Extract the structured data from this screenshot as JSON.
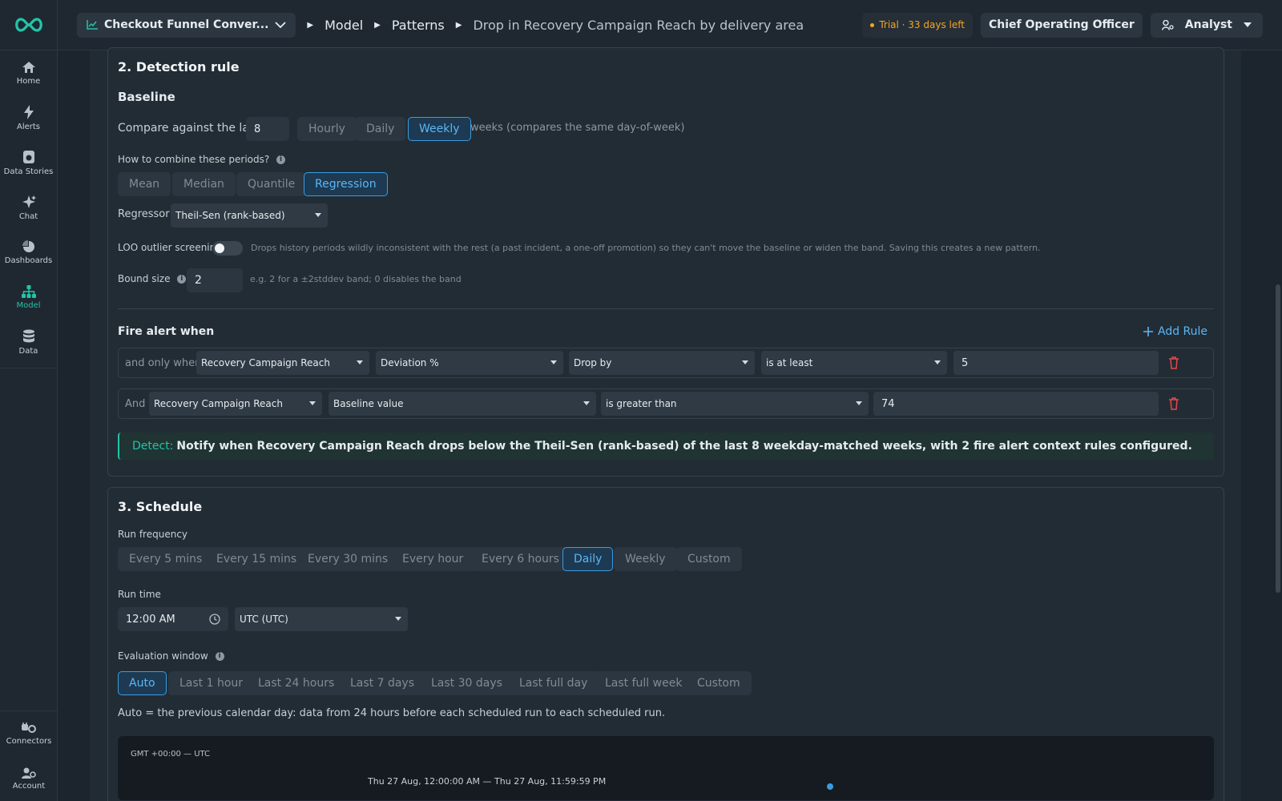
{
  "nav": {
    "items": [
      {
        "label": "Home",
        "icon": "home-icon"
      },
      {
        "label": "Alerts",
        "icon": "bolt-icon"
      },
      {
        "label": "Data Stories",
        "icon": "story-icon"
      },
      {
        "label": "Chat",
        "icon": "sparkle-icon"
      },
      {
        "label": "Dashboards",
        "icon": "pie-icon"
      },
      {
        "label": "Model",
        "icon": "hierarchy-icon"
      },
      {
        "label": "Data",
        "icon": "database-icon"
      }
    ],
    "bottom": [
      {
        "label": "Connectors",
        "icon": "plug-icon"
      },
      {
        "label": "Account",
        "icon": "account-icon"
      }
    ],
    "active_color": "#23c4a8"
  },
  "topbar": {
    "project": "Checkout Funnel Conver...",
    "breadcrumbs": [
      "Model",
      "Patterns",
      "Drop in Recovery Campaign Reach by delivery area"
    ],
    "trial": "Trial · 33 days left",
    "role": "Chief Operating Officer",
    "user": "Analyst"
  },
  "detection": {
    "title": "2. Detection rule",
    "baseline_title": "Baseline",
    "compare_label": "Compare against the last",
    "compare_value": "8",
    "periods": [
      "Hourly",
      "Daily",
      "Weekly"
    ],
    "selected_period": "Weekly",
    "period_hint": "weeks (compares the same day-of-week)",
    "combine_label": "How to combine these periods?",
    "combine": [
      "Mean",
      "Median",
      "Quantile",
      "Regression"
    ],
    "selected_combine": "Regression",
    "regressor_label": "Regressor",
    "regressor_value": "Theil-Sen (rank-based)",
    "loo_label": "LOO outlier screening",
    "loo_hint": "Drops history periods wildly inconsistent with the rest (a past incident, a one-off promotion) so they can't move the baseline or widen the band. Saving this creates a new pattern.",
    "bound_label": "Bound size",
    "bound_value": "2",
    "bound_hint": "e.g. 2 for a ±2stddev band; 0 disables the band",
    "fire_title": "Fire alert when",
    "add_rule": "Add Rule",
    "rules": [
      {
        "prefix": "and only when",
        "metric": "Recovery Campaign Reach",
        "measure": "Deviation %",
        "direction": "Drop by",
        "op": "is at least",
        "value": "5"
      },
      {
        "prefix": "And",
        "metric": "Recovery Campaign Reach",
        "measure": "Baseline value",
        "op": "is greater than",
        "value": "74"
      }
    ],
    "detect_key": "Detect:",
    "detect_text": "Notify when Recovery Campaign Reach drops below the Theil-Sen (rank-based) of the last 8 weekday-matched weeks, with 2 fire alert context rules configured."
  },
  "schedule": {
    "title": "3. Schedule",
    "freq_label": "Run frequency",
    "freqs": [
      "Every 5 mins",
      "Every 15 mins",
      "Every 30 mins",
      "Every hour",
      "Every 6 hours",
      "Daily",
      "Weekly",
      "Custom"
    ],
    "selected_freq": "Daily",
    "time_label": "Run time",
    "time_value": "12:00 AM",
    "tz_value": "UTC (UTC)",
    "window_label": "Evaluation window",
    "windows": [
      "Auto",
      "Last 1 hour",
      "Last 24 hours",
      "Last 7 days",
      "Last 30 days",
      "Last full day",
      "Last full week",
      "Custom"
    ],
    "selected_window": "Auto",
    "window_hint": "Auto = the previous calendar day: data from 24 hours before each scheduled run to each scheduled run.",
    "tz_caption": "GMT +00:00 — UTC",
    "range_caption": "Thu 27 Aug, 12:00:00 AM — Thu 27 Aug, 11:59:59 PM"
  },
  "colors": {
    "accent": "#23c4a8",
    "select_blue": "#3a9ce0",
    "danger": "#e5484d",
    "warning": "#f5a623"
  }
}
